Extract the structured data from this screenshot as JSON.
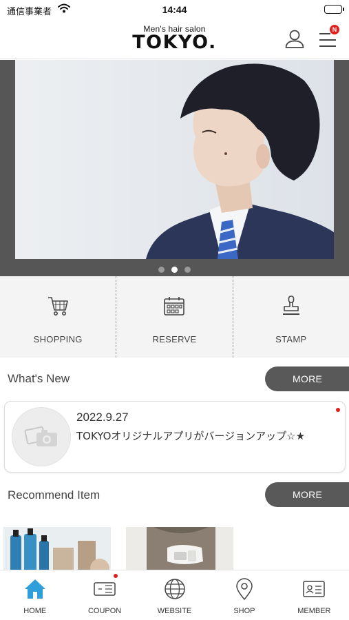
{
  "status_bar": {
    "carrier": "通信事業者",
    "time": "14:44"
  },
  "header": {
    "logo_sub": "Men's hair salon",
    "logo_main": "TOKYO.",
    "menu_badge": "N"
  },
  "carousel": {
    "slide_count": 3,
    "active_index": 1
  },
  "features": [
    {
      "label": "SHOPPING",
      "icon": "cart-icon"
    },
    {
      "label": "RESERVE",
      "icon": "calendar-icon"
    },
    {
      "label": "STAMP",
      "icon": "stamp-icon"
    }
  ],
  "whats_new": {
    "title": "What's New",
    "more_label": "MORE",
    "items": [
      {
        "date": "2022.9.27",
        "text": "TOKYOオリジナルアプリがバージョンアップ☆★",
        "unread": true
      }
    ]
  },
  "recommend": {
    "title": "Recommend Item",
    "more_label": "MORE"
  },
  "tabbar": [
    {
      "label": "HOME",
      "icon": "home-icon",
      "active": true
    },
    {
      "label": "COUPON",
      "icon": "coupon-icon",
      "badge": true
    },
    {
      "label": "WEBSITE",
      "icon": "globe-icon"
    },
    {
      "label": "SHOP",
      "icon": "map-pin-icon"
    },
    {
      "label": "MEMBER",
      "icon": "member-card-icon"
    }
  ],
  "colors": {
    "accent_blue": "#2f9fdb",
    "badge_red": "#e0201c",
    "button_gray": "#595959",
    "hero_frame": "#565656"
  }
}
